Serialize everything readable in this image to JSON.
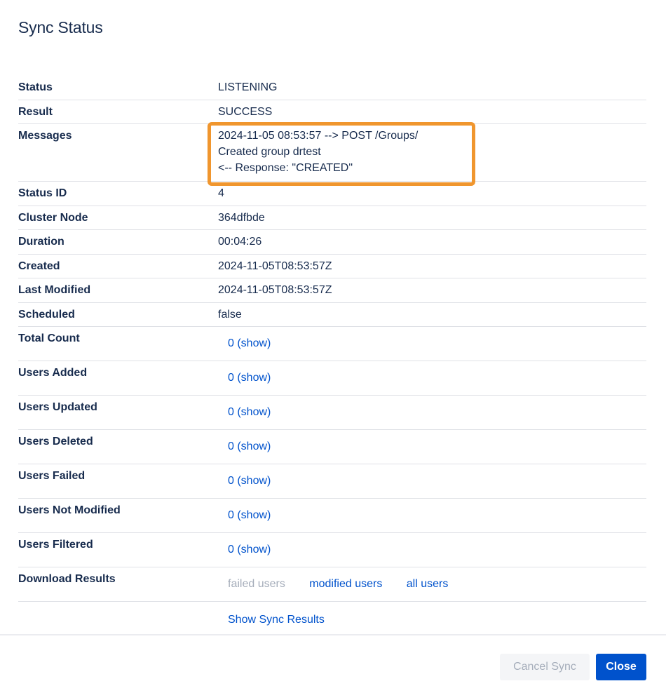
{
  "dialog": {
    "title": "Sync Status"
  },
  "rows": {
    "status": {
      "label": "Status",
      "value": "LISTENING"
    },
    "result": {
      "label": "Result",
      "value": "SUCCESS"
    },
    "messages": {
      "label": "Messages",
      "lines": [
        "2024-11-05 08:53:57 --> POST /Groups/",
        "Created group drtest",
        "<-- Response: \"CREATED\""
      ]
    },
    "status_id": {
      "label": "Status ID",
      "value": "4"
    },
    "cluster_node": {
      "label": "Cluster Node",
      "value": "364dfbde"
    },
    "duration": {
      "label": "Duration",
      "value": "00:04:26"
    },
    "created": {
      "label": "Created",
      "value": "2024-11-05T08:53:57Z"
    },
    "last_modified": {
      "label": "Last Modified",
      "value": "2024-11-05T08:53:57Z"
    },
    "scheduled": {
      "label": "Scheduled",
      "value": "false"
    },
    "total_count": {
      "label": "Total Count",
      "value": "0 (show)"
    },
    "users_added": {
      "label": "Users Added",
      "value": "0 (show)"
    },
    "users_updated": {
      "label": "Users Updated",
      "value": "0 (show)"
    },
    "users_deleted": {
      "label": "Users Deleted",
      "value": "0 (show)"
    },
    "users_failed": {
      "label": "Users Failed",
      "value": "0 (show)"
    },
    "users_not_modified": {
      "label": "Users Not Modified",
      "value": "0 (show)"
    },
    "users_filtered": {
      "label": "Users Filtered",
      "value": "0 (show)"
    },
    "download_results": {
      "label": "Download Results",
      "failed_users": "failed users",
      "modified_users": "modified users",
      "all_users": "all users"
    },
    "show_sync_results": "Show Sync Results"
  },
  "footer": {
    "cancel_label": "Cancel Sync",
    "close_label": "Close"
  },
  "colors": {
    "link": "#0052CC",
    "highlight": "#F0962E",
    "primary": "#0052CC"
  }
}
